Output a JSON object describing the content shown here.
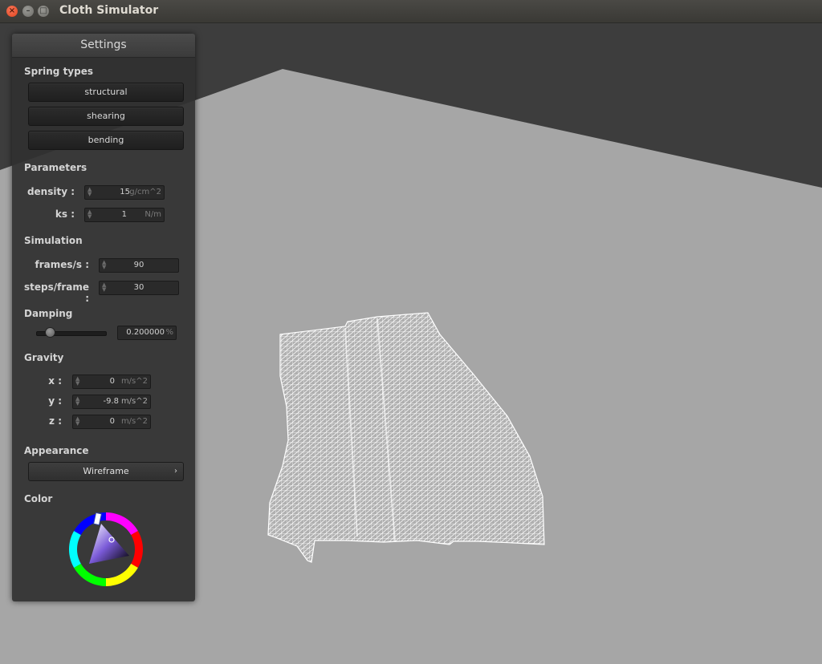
{
  "window": {
    "title": "Cloth Simulator"
  },
  "icons": {
    "close": "close-icon",
    "minimize": "minimize-icon",
    "maximize": "maximize-icon"
  },
  "panel": {
    "title": "Settings",
    "spring_types": {
      "heading": "Spring types",
      "buttons": [
        "structural",
        "shearing",
        "bending"
      ]
    },
    "parameters": {
      "heading": "Parameters",
      "density": {
        "label": "density :",
        "value": "15",
        "unit": "g/cm^2"
      },
      "ks": {
        "label": "ks :",
        "value": "1",
        "unit": "N/m"
      }
    },
    "simulation": {
      "heading": "Simulation",
      "fps": {
        "label": "frames/s :",
        "value": "90"
      },
      "steps": {
        "label": "steps/frame :",
        "value": "30"
      }
    },
    "damping": {
      "heading": "Damping",
      "value": "0.200000",
      "unit": "%",
      "slider_fraction": 0.2
    },
    "gravity": {
      "heading": "Gravity",
      "x": {
        "label": "x :",
        "value": "0",
        "unit": "m/s^2"
      },
      "y": {
        "label": "y :",
        "value": "-9.8",
        "unit": "m/s^2"
      },
      "z": {
        "label": "z :",
        "value": "0",
        "unit": "m/s^2"
      }
    },
    "appearance": {
      "heading": "Appearance",
      "selected": "Wireframe"
    },
    "color": {
      "heading": "Color",
      "selected_hex": "#ffffff"
    }
  },
  "scene": {
    "background_color": "#3d3d3d",
    "floor_color": "#a6a6a6",
    "cloth_color": "#ffffff",
    "render_mode": "Wireframe"
  }
}
